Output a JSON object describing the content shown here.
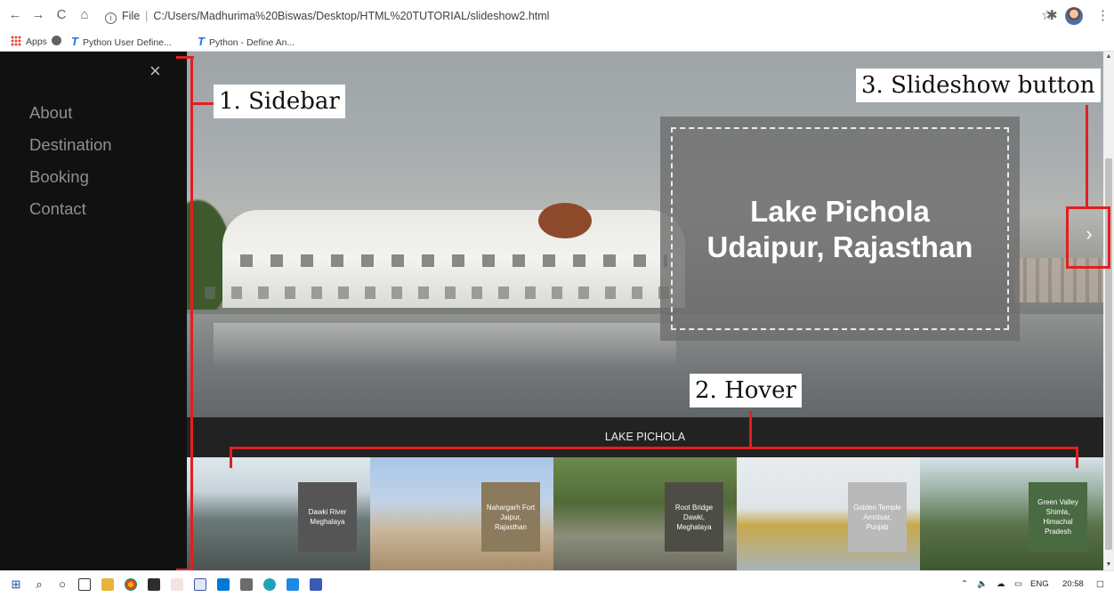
{
  "browser": {
    "nav": {
      "back": "←",
      "forward": "→",
      "reload": "C",
      "home": "⌂"
    },
    "address": {
      "scheme_label": "File",
      "path": "C:/Users/Madhurima%20Biswas/Desktop/HTML%20TUTORIAL/slideshow2.html"
    },
    "right_icons": {
      "star": "☆",
      "extensions": "✱",
      "menu": "⋮"
    },
    "bookmarks": [
      {
        "label": "Apps"
      },
      {
        "label": "Python User Define..."
      },
      {
        "label": "Python - Define An..."
      }
    ]
  },
  "sidebar": {
    "close_glyph": "×",
    "items": [
      "About",
      "Destination",
      "Booking",
      "Contact"
    ]
  },
  "slideshow": {
    "caption_line1": "Lake Pichola",
    "caption_line2": "Udaipur, Rajasthan",
    "next_glyph": "›",
    "current_title": "LAKE PICHOLA",
    "thumbnails": [
      {
        "caption": "Dawki River Meghalaya",
        "caption_color": "#555555"
      },
      {
        "caption": "Nahargarh Fort Jaipur, Rajasthan",
        "caption_color": "#8c7a5c"
      },
      {
        "caption": "Root Bridge Dawki, Meghalaya",
        "caption_color": "#4d4d45"
      },
      {
        "caption": "Golden Temple Amritsar, Punjab",
        "caption_color": "#b9b9b9"
      },
      {
        "caption": "Green Valley Shimla, Himachal Pradesh",
        "caption_color": "#4a6a42"
      }
    ]
  },
  "annotations": {
    "sidebar_label": "1. Sidebar",
    "hover_label": "2. Hover",
    "slideshow_button_label": "3. Slideshow button",
    "accent_color": "#e02020"
  },
  "taskbar": {
    "start_glyph": "⊞",
    "search_glyph": "⌕",
    "cortana_glyph": "○",
    "tray_language": "ENG",
    "clock": "20:58"
  }
}
